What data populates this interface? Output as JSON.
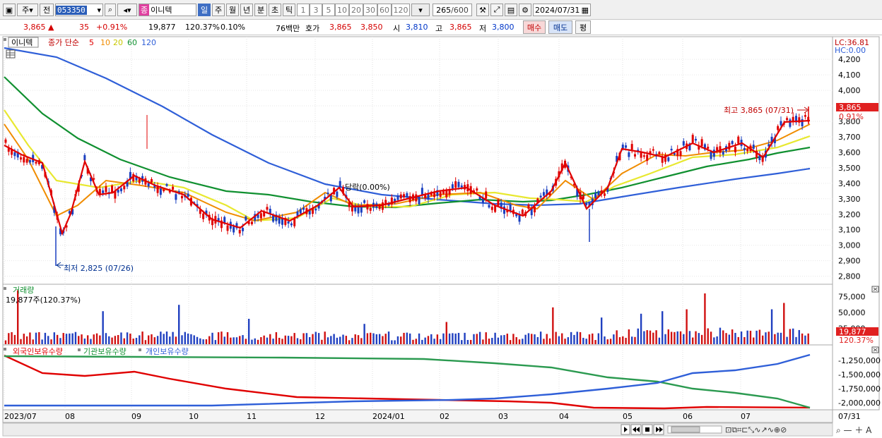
{
  "toolbar": {
    "view_toggle": "주",
    "view_toggle2": "전",
    "code": "053350",
    "stock_name": "이니텍",
    "periods": [
      "일",
      "주",
      "월",
      "년",
      "분",
      "초",
      "틱"
    ],
    "active_period": "일",
    "intervals": [
      "1",
      "3",
      "5",
      "10",
      "20",
      "30",
      "60",
      "120"
    ],
    "count": "265",
    "count_total": "/600",
    "date": "2024/07/31"
  },
  "quote": {
    "price": "3,865",
    "change": "35",
    "change_pct": "+0.91%",
    "volume": "19,877",
    "volume_pct": "120.37%",
    "turnover": "0.10%",
    "amount": "76백만",
    "hoga_label": "호가",
    "ask": "3,865",
    "bid": "3,850",
    "open_label": "시",
    "open": "3,810",
    "high_label": "고",
    "high": "3,865",
    "low_label": "저",
    "low": "3,800",
    "buy_btn": "매수",
    "sell_btn": "매도",
    "eval_btn": "평"
  },
  "price_panel": {
    "name_tag": "이니텍",
    "legend": {
      "prefix": "종가 단순",
      "periods": [
        "5",
        "10",
        "20",
        "60",
        "120"
      ],
      "colors": [
        "#e00000",
        "#f08c00",
        "#e6e600",
        "#109030",
        "#2f5fd8"
      ]
    },
    "lc": "LC:36.81",
    "hc": "HC:0.00",
    "y_ticks": [
      "4,200",
      "4,100",
      "4,000",
      "3,900",
      "3,800",
      "3,700",
      "3,600",
      "3,500",
      "3,400",
      "3,300",
      "3,200",
      "3,100",
      "3,000",
      "2,900",
      "2,800"
    ],
    "current_tag": "3,865",
    "current_pct": "0.91%",
    "high_annotation": "최고 3,865 (07/31)",
    "low_annotation": "최저 2,825 (07/26)",
    "mid_annotation": "당락(0.00%)"
  },
  "volume_panel": {
    "title": "거래량",
    "value": "19,877주(120.37%)",
    "y_ticks": [
      "75,000",
      "50,000",
      "25,000"
    ],
    "current_tag": "19,877",
    "current_pct": "120.37%"
  },
  "holdings_panel": {
    "legend": [
      "외국인보유수량",
      "기관보유수량",
      "개인보유수량"
    ],
    "colors": [
      "#e00000",
      "#109030",
      "#2f5fd8"
    ],
    "y_ticks": [
      "-1,250,000",
      "-1,500,000",
      "-1,750,000",
      "-2,000,000"
    ]
  },
  "x_axis": {
    "labels": [
      "2023/07",
      "08",
      "09",
      "10",
      "11",
      "12",
      "2024/01",
      "02",
      "03",
      "04",
      "05",
      "06",
      "07"
    ],
    "right_label": "07/31"
  },
  "chart_data": [
    {
      "type": "line",
      "title": "이니텍",
      "series": [
        {
          "name": "5",
          "color": "#e00000",
          "values": [
            3600,
            3550,
            3100,
            3300,
            3450,
            3300,
            3350,
            3400,
            3380,
            3350,
            3300,
            3250,
            3200,
            3150,
            3100,
            3150,
            3200,
            3180,
            3220,
            3250,
            3400,
            3350,
            3250,
            3230,
            3250,
            3280,
            3300,
            3400,
            3300,
            3250,
            3200,
            3250,
            3450,
            3400,
            3300,
            3500,
            3550,
            3500,
            3600,
            3650,
            3620,
            3700,
            3650,
            3600,
            3650,
            3700,
            3750,
            3800,
            3820
          ]
        },
        {
          "name": "120",
          "color": "#2f5fd8",
          "values": [
            4250,
            4150,
            4000,
            3850,
            3700,
            3600,
            3500,
            3420,
            3360,
            3320,
            3300,
            3290,
            3280,
            3270,
            3275,
            3290,
            3320,
            3360,
            3400,
            3440,
            3470
          ]
        }
      ],
      "ylim": [
        2780,
        4260
      ]
    },
    {
      "type": "bar",
      "title": "거래량",
      "ylim": [
        0,
        90000
      ]
    },
    {
      "type": "line",
      "series": [
        {
          "name": "외국인보유수량",
          "color": "#e00000"
        },
        {
          "name": "기관보유수량",
          "color": "#109030"
        },
        {
          "name": "개인보유수량",
          "color": "#2f5fd8"
        }
      ],
      "ylim": [
        -2100000,
        -1100000
      ]
    }
  ]
}
